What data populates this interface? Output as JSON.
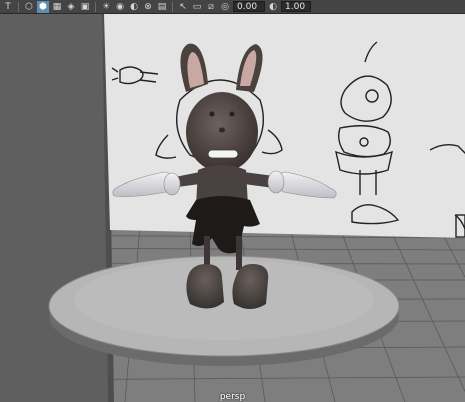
{
  "toolbar": {
    "buttons": [
      {
        "icon": "camera-select-icon",
        "glyph": "T"
      },
      {
        "icon": "wireframe-cube-icon",
        "glyph": "⬡"
      },
      {
        "icon": "shaded-cube-icon",
        "glyph": "⬢",
        "active": true
      },
      {
        "icon": "textured-cube-icon",
        "glyph": "▦"
      },
      {
        "icon": "lights-cube-icon",
        "glyph": "◈"
      },
      {
        "icon": "shadow-cube-icon",
        "glyph": "▣"
      },
      {
        "icon": "light-bulb-icon",
        "glyph": "☀"
      },
      {
        "icon": "camera-icon",
        "glyph": "◉"
      },
      {
        "icon": "xray-icon",
        "glyph": "◐"
      },
      {
        "icon": "isolate-icon",
        "glyph": "⊗"
      },
      {
        "icon": "grid-toggle-icon",
        "glyph": "▤"
      },
      {
        "icon": "cursor-icon",
        "glyph": "↖"
      },
      {
        "icon": "film-gate-icon",
        "glyph": "▭"
      },
      {
        "icon": "resolution-gate-icon",
        "glyph": "⧄"
      },
      {
        "icon": "exposure-icon",
        "glyph": "◎"
      }
    ],
    "exposure_value": "0.00",
    "gamma_value": "1.00"
  },
  "viewport": {
    "camera_label": "persp"
  }
}
